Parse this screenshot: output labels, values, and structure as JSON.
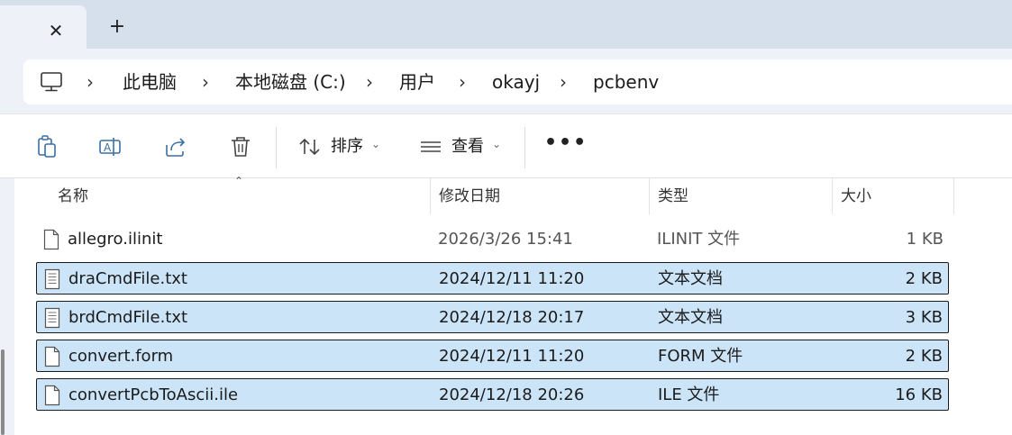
{
  "tabs": {
    "close_glyph": "✕",
    "new_glyph": "+"
  },
  "breadcrumb": {
    "separator": "›",
    "items": [
      "此电脑",
      "本地磁盘 (C:)",
      "用户",
      "okayj",
      "pcbenv"
    ]
  },
  "toolbar": {
    "sort_label": "排序",
    "view_label": "查看",
    "more_label": "•••",
    "icons": [
      "copy-icon",
      "rename-icon",
      "share-icon",
      "delete-icon",
      "sort-icon",
      "view-icon",
      "more-icon"
    ]
  },
  "columns": {
    "name": "名称",
    "modified": "修改日期",
    "type": "类型",
    "size": "大小"
  },
  "files": [
    {
      "name": "allegro.ilinit",
      "modified": "2026/3/26 15:41",
      "type": "ILINIT 文件",
      "size": "1 KB",
      "selected": false,
      "icon": "file-icon"
    },
    {
      "name": "draCmdFile.txt",
      "modified": "2024/12/11 11:20",
      "type": "文本文档",
      "size": "2 KB",
      "selected": true,
      "icon": "text-file-icon"
    },
    {
      "name": "brdCmdFile.txt",
      "modified": "2024/12/18 20:17",
      "type": "文本文档",
      "size": "3 KB",
      "selected": true,
      "icon": "text-file-icon"
    },
    {
      "name": "convert.form",
      "modified": "2024/12/11 11:20",
      "type": "FORM 文件",
      "size": "2 KB",
      "selected": true,
      "icon": "file-icon"
    },
    {
      "name": "convertPcbToAscii.ile",
      "modified": "2024/12/18 20:26",
      "type": "ILE 文件",
      "size": "16 KB",
      "selected": true,
      "icon": "file-icon"
    }
  ],
  "colors": {
    "selection": "#cce4f7",
    "chrome": "#eef2f8",
    "tabstrip": "#d6e0ec"
  }
}
